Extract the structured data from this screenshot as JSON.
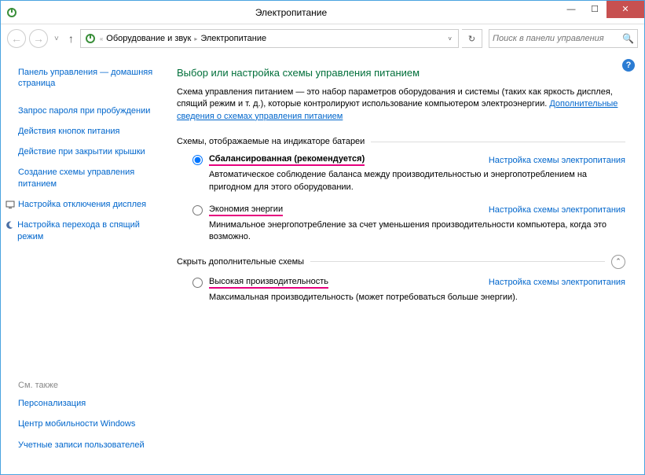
{
  "window": {
    "title": "Электропитание"
  },
  "breadcrumb": {
    "item1": "Оборудование и звук",
    "item2": "Электропитание"
  },
  "search": {
    "placeholder": "Поиск в панели управления"
  },
  "sidebar": {
    "home": "Панель управления — домашняя страница",
    "items": [
      "Запрос пароля при пробуждении",
      "Действия кнопок питания",
      "Действие при закрытии крышки",
      "Создание схемы управления питанием",
      "Настройка отключения дисплея",
      "Настройка перехода в спящий режим"
    ],
    "see_also_h": "См. также",
    "see_also": [
      "Персонализация",
      "Центр мобильности Windows",
      "Учетные записи пользователей"
    ]
  },
  "main": {
    "heading": "Выбор или настройка схемы управления питанием",
    "intro_a": "Схема управления питанием — это набор параметров оборудования и системы (таких как яркость дисплея, спящий режим и т. д.), которые контролируют использование компьютером электроэнергии. ",
    "intro_link": "Дополнительные сведения о схемах управления питанием",
    "group1": "Схемы, отображаемые на индикаторе батареи",
    "group2": "Скрыть дополнительные схемы",
    "plan_link": "Настройка схемы электропитания",
    "plans": [
      {
        "name": "Сбалансированная (рекомендуется)",
        "desc": "Автоматическое соблюдение баланса между производительностью и энергопотреблением на пригодном для этого оборудовании."
      },
      {
        "name": "Экономия энергии",
        "desc": "Минимальное энергопотребление за счет уменьшения производительности компьютера, когда это возможно."
      },
      {
        "name": "Высокая производительность",
        "desc": "Максимальная производительность (может потребоваться больше энергии)."
      }
    ]
  }
}
